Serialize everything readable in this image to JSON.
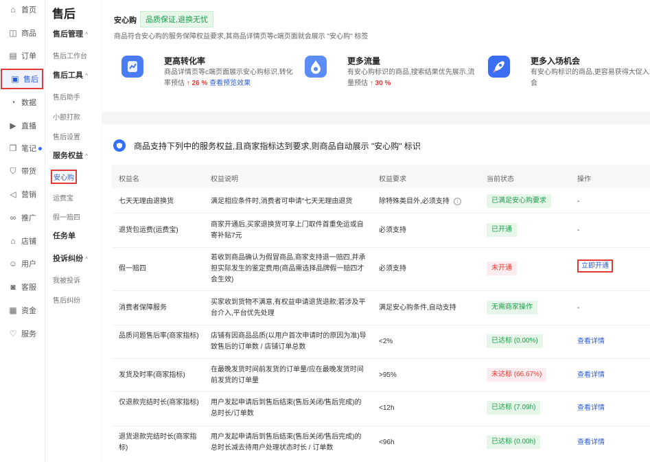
{
  "rail": {
    "items": [
      {
        "icon": "home-icon",
        "label": "首页"
      },
      {
        "icon": "product-icon",
        "label": "商品"
      },
      {
        "icon": "order-icon",
        "label": "订单"
      },
      {
        "icon": "aftersale-icon",
        "label": "售后"
      },
      {
        "icon": "data-icon",
        "label": "数据"
      },
      {
        "icon": "live-icon",
        "label": "直播"
      },
      {
        "icon": "notes-icon",
        "label": "笔记"
      },
      {
        "icon": "bag-icon",
        "label": "带货"
      },
      {
        "icon": "marketing-icon",
        "label": "营销"
      },
      {
        "icon": "promote-icon",
        "label": "推广"
      },
      {
        "icon": "shop-icon",
        "label": "店铺"
      },
      {
        "icon": "user-icon",
        "label": "用户"
      },
      {
        "icon": "service-chat-icon",
        "label": "客服"
      },
      {
        "icon": "fund-icon",
        "label": "资金"
      },
      {
        "icon": "service-icon",
        "label": "服务"
      }
    ]
  },
  "sub": {
    "title": "售后",
    "groups": [
      {
        "label": "售后管理",
        "chevron": "^",
        "items": [
          "售后工作台"
        ]
      },
      {
        "label": "售后工具",
        "chevron": "^",
        "items": [
          "售后助手",
          "小额打款",
          "售后设置"
        ]
      },
      {
        "label": "服务权益",
        "chevron": "^",
        "items": [
          "安心购",
          "运费宝",
          "假一赔四"
        ]
      },
      {
        "label": "任务单",
        "chevron": "",
        "items": []
      },
      {
        "label": "投诉纠纷",
        "chevron": "^",
        "items": [
          "我被投诉",
          "售后纠纷"
        ]
      }
    ]
  },
  "header": {
    "title": "安心购",
    "badge": "品质保证,退换无忧",
    "intro": "商品符合安心购的服务保障权益要求,其商品详情页等c端页面就会展示 \"安心购\" 标签"
  },
  "features": [
    {
      "title": "更高转化率",
      "desc": "商品详情页等c端页面展示安心购标识,转化率预估",
      "up": "↑ 26 %",
      "link": "查看预览效果",
      "color": "#4a7cf6"
    },
    {
      "title": "更多流量",
      "desc": "有安心购标识的商品,搜索结果优先展示,流量预估",
      "up": "↑ 30 %",
      "link": "",
      "color": "#5b8cf7"
    },
    {
      "title": "更多入场机会",
      "desc": "有安心购标识的商品,更容易获得大促入场机会",
      "up": "",
      "link": "",
      "color": "#3b6ef2"
    }
  ],
  "table": {
    "heading": "商品支持下列中的服务权益,且商家指标达到要求,则商品自动展示 \"安心购\" 标识",
    "columns": [
      "权益名",
      "权益说明",
      "权益要求",
      "当前状态",
      "操作"
    ],
    "rows": [
      {
        "name": "七天无理由退换货",
        "desc": "满足相应条件时,消费者可申请\"七天无理由退货",
        "req": "除特殊类目外,必须支持",
        "status": "已满足安心购要求",
        "status_type": "ok",
        "op": "-",
        "op_type": "text"
      },
      {
        "name": "退货包运费(运费宝)",
        "desc": "商家开通后,买家退换货可享上门取件首重免运或自寄补贴7元",
        "req": "必须支持",
        "status": "已开通",
        "status_type": "ok",
        "op": "-",
        "op_type": "text"
      },
      {
        "name": "假一赔四",
        "desc": "若收到商品确认为假冒商品,商家支持退一赔四,并承担实际发生的鉴定费用(商品需选择品牌假一赔四才会生效)",
        "req": "必须支持",
        "status": "未开通",
        "status_type": "no",
        "op": "立即开通",
        "op_type": "button"
      },
      {
        "name": "消费者保障服务",
        "desc": "买家收到货物不满意,有权益申请退货退款;若涉及平台介入,平台优先处理",
        "req": "满足安心购条件,自动支持",
        "status": "无需商家操作",
        "status_type": "ok",
        "op": "-",
        "op_type": "text"
      },
      {
        "name": "品质问题售后率(商家指标)",
        "desc": "店铺有因商品品质(以用户首次申请时的原因为准)导致售后的订单数 / 店铺订单总数",
        "req": "<2%",
        "status": "已达标 (0.00%)",
        "status_type": "ok",
        "op": "查看详情",
        "op_type": "link"
      },
      {
        "name": "发货及时率(商家指标)",
        "desc": "在最晚发货时间前发货的订单量/应在最晚发货时间前发货的订单量",
        "req": ">95%",
        "status": "未达标 (66.67%)",
        "status_type": "no",
        "op": "查看详情",
        "op_type": "link"
      },
      {
        "name": "仅退款完结时长(商家指标)",
        "desc": "用户发起申请后到售后结束(售后关闭/售后完成)的总时长/订单数",
        "req": "<12h",
        "status": "已达标 (7.09h)",
        "status_type": "ok",
        "op": "查看详情",
        "op_type": "link"
      },
      {
        "name": "退货退款完结时长(商家指标)",
        "desc": "用户发起申请后到售后结束(售后关闭/售后完成)的总时长减去待用户处理状态时长 / 订单数",
        "req": "<96h",
        "status": "已达标 (0.00h)",
        "status_type": "ok",
        "op": "查看详情",
        "op_type": "link"
      }
    ]
  }
}
